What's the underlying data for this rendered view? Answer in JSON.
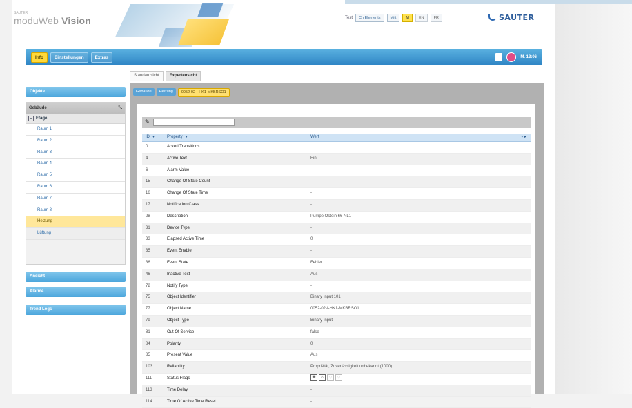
{
  "header": {
    "brand_small": "SAUTER",
    "brand_a": "moduWeb",
    "brand_b": "Vision",
    "tools_label": "Test",
    "chip1": "Cn Elements",
    "chip2": "Mitt",
    "lang_de": "M",
    "lang_en": "EN",
    "lang_fr": "FR",
    "logo": "SAUTER"
  },
  "nav": {
    "tabs": [
      "Info",
      "Einstellungen",
      "Extras"
    ],
    "user": "M. 13:06"
  },
  "sidebar": {
    "btn_top": "Objekte",
    "toolbar_title": "Gebäude",
    "group": "Etage",
    "items": [
      "Raum 1",
      "Raum 2",
      "Raum 3",
      "Raum 4",
      "Raum 5",
      "Raum 6",
      "Raum 7",
      "Raum 8"
    ],
    "sel_item": "Heizung",
    "alt_item": "Lüftung",
    "btn2": "Ansicht",
    "btn3": "Alarme",
    "btn4": "Trend Logs"
  },
  "views": {
    "tab1": "Standardsicht",
    "tab2": "Expertensicht"
  },
  "breadcrumb": {
    "c1": "Gebäude",
    "c2": "Heizung",
    "c3": "0052-02-I-HK1-MKBRSO1"
  },
  "filter": {
    "placeholder": ""
  },
  "table": {
    "col_id": "ID",
    "col_prop": "Property",
    "col_val": "Wert",
    "rows": [
      {
        "id": "0",
        "prop": "Ackerl Transitions",
        "val": ""
      },
      {
        "id": "4",
        "prop": "Active Text",
        "val": "Ein"
      },
      {
        "id": "6",
        "prop": "Alarm Value",
        "val": "-"
      },
      {
        "id": "15",
        "prop": "Change Of State Count",
        "val": "-"
      },
      {
        "id": "16",
        "prop": "Change Of State Time",
        "val": "-"
      },
      {
        "id": "17",
        "prop": "Notification Class",
        "val": "-"
      },
      {
        "id": "28",
        "prop": "Description",
        "val": "Pumpe Ostein 66 NL1"
      },
      {
        "id": "31",
        "prop": "Device Type",
        "val": "-"
      },
      {
        "id": "33",
        "prop": "Elapsed Active Time",
        "val": "0"
      },
      {
        "id": "35",
        "prop": "Event Enable",
        "val": "-"
      },
      {
        "id": "36",
        "prop": "Event State",
        "val": "Fehler"
      },
      {
        "id": "46",
        "prop": "Inactive Text",
        "val": "Aus"
      },
      {
        "id": "72",
        "prop": "Notify Type",
        "val": "-"
      },
      {
        "id": "75",
        "prop": "Object Identifier",
        "val": "Binary Input 101"
      },
      {
        "id": "77",
        "prop": "Object Name",
        "val": "0052-02-I-HK1-MKBRSO1"
      },
      {
        "id": "79",
        "prop": "Object Type",
        "val": "Binary Input"
      },
      {
        "id": "81",
        "prop": "Out Of Service",
        "val": "false"
      },
      {
        "id": "84",
        "prop": "Polarity",
        "val": "0"
      },
      {
        "id": "85",
        "prop": "Present Value",
        "val": "Aus"
      },
      {
        "id": "103",
        "prop": "Reliability",
        "val": "Propriétär, Zuverlässigkeit unbekannt (1000)"
      },
      {
        "id": "111",
        "prop": "Status Flags",
        "val": ""
      },
      {
        "id": "113",
        "prop": "Time Delay",
        "val": "-"
      },
      {
        "id": "114",
        "prop": "Time Of Active Time Reset",
        "val": "-"
      }
    ]
  },
  "colors": {
    "accent": "#2e84c4",
    "selected": "#ffe79a",
    "active_tab": "#ffd93a"
  }
}
